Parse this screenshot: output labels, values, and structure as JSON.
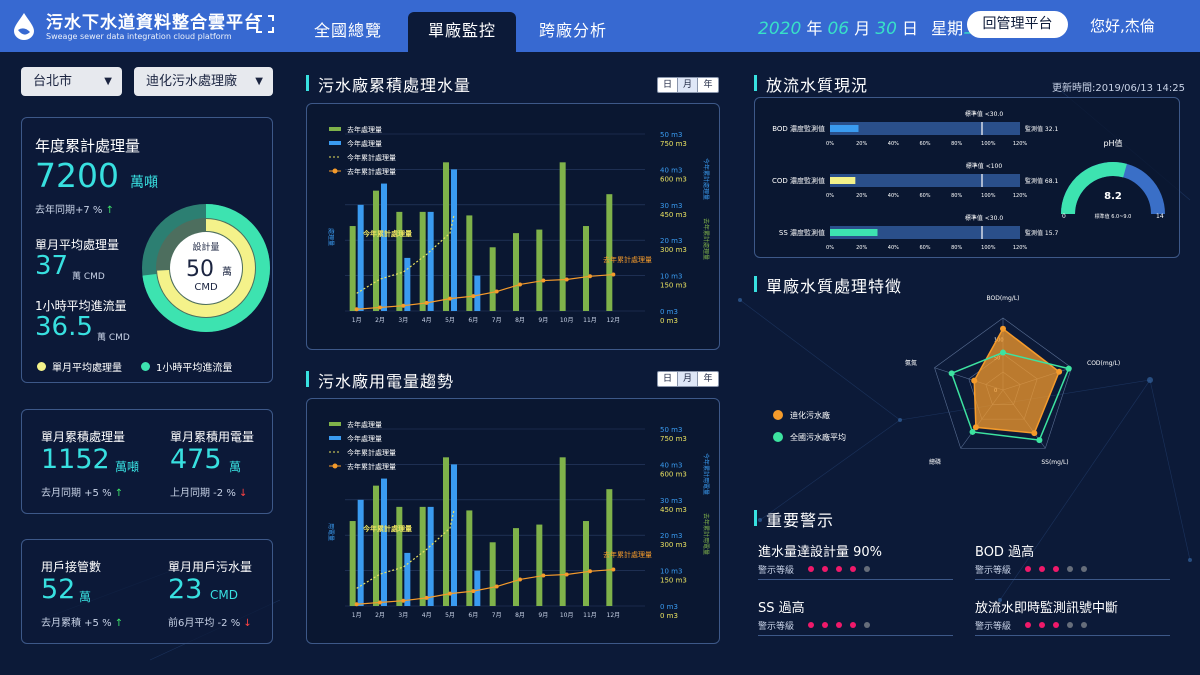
{
  "header": {
    "title": "污水下水道資料整合雲平台",
    "subtitle": "Sweage sewer data integration cloud platform",
    "tabs": [
      "全國總覽",
      "單廠監控",
      "跨廠分析"
    ],
    "date": {
      "year": "2020",
      "y_unit": "年",
      "month": "06",
      "m_unit": "月",
      "day": "30",
      "d_unit": "日",
      "weekday_label": "星期",
      "weekday": "二"
    },
    "admin_button": "回管理平台",
    "greeting": "您好,杰倫"
  },
  "filters": {
    "city": "台北市",
    "plant": "迪化污水處理廠"
  },
  "annual": {
    "title": "年度累計處理量",
    "value": "7200",
    "unit": "萬噸",
    "yoy": "去年同期+7 %",
    "monthly_avg_label": "單月平均處理量",
    "monthly_avg_value": "37",
    "monthly_avg_unit": "萬 CMD",
    "hourly_label": "1小時平均進流量",
    "hourly_value": "36.5",
    "hourly_unit": "萬 CMD",
    "gauge": {
      "label": "設計量",
      "value": "50",
      "unit": "萬",
      "sub": "CMD",
      "ratio_monthly": 0.74,
      "ratio_hourly": 0.73
    },
    "legend": [
      "單月平均處理量",
      "1小時平均進流量"
    ],
    "colors": {
      "monthly": "#f4f28a",
      "hourly": "#3de3b0"
    }
  },
  "monthly": {
    "treat_label": "單月累積處理量",
    "treat_value": "1152",
    "treat_unit": "萬噸",
    "treat_cmp": "去月同期 +5 %",
    "power_label": "單月累積用電量",
    "power_value": "475",
    "power_unit": "萬",
    "power_cmp": "上月同期 -2 %"
  },
  "users": {
    "conn_label": "用戶接管數",
    "conn_value": "52",
    "conn_unit": "萬",
    "conn_cmp": "去月累積 +5 %",
    "usage_label": "單月用戶污水量",
    "usage_value": "23",
    "usage_unit": "CMD",
    "usage_cmp": "前6月平均 -2 %"
  },
  "chart_water": {
    "title": "污水廠累積處理水量",
    "toggle": [
      "日",
      "月",
      "年"
    ],
    "toggle_active": 1
  },
  "chart_power": {
    "title": "污水廠用電量趨勢",
    "toggle": [
      "日",
      "月",
      "年"
    ],
    "toggle_active": 1
  },
  "chart_legend": [
    "去年處理量",
    "今年處理量",
    "今年累計處理量",
    "去年累計處理量"
  ],
  "chart_data": [
    {
      "type": "bar",
      "title": "污水廠累積處理水量",
      "categories": [
        "1月",
        "2月",
        "3月",
        "4月",
        "5月",
        "6月",
        "7月",
        "8月",
        "9月",
        "10月",
        "11月",
        "12月"
      ],
      "series": [
        {
          "name": "去年處理量",
          "values": [
            24,
            34,
            28,
            28,
            42,
            27,
            18,
            22,
            23,
            42,
            24,
            33
          ]
        },
        {
          "name": "今年處理量",
          "values": [
            30,
            36,
            15,
            28,
            40,
            10,
            null,
            null,
            null,
            null,
            null,
            null
          ]
        },
        {
          "name": "今年累計處理量",
          "values": [
            5,
            9,
            11,
            16,
            22,
            null,
            null,
            null,
            null,
            null,
            null,
            null
          ]
        },
        {
          "name": "去年累計處理量",
          "values": [
            0.5,
            1.0,
            1.5,
            2.3,
            3.5,
            4.2,
            5.5,
            7.5,
            8.6,
            8.9,
            9.8,
            10.3
          ]
        }
      ],
      "left_ylabel": "處理量",
      "right_ylabel_1": "今年累計處理量",
      "right_ylabel_2": "去年累計處理量",
      "right_axis_1": [
        "50 m3",
        "40 m3",
        "30 m3",
        "20 m3",
        "10 m3",
        "0 m3"
      ],
      "right_axis_2": [
        "750 m3",
        "600 m3",
        "450 m3",
        "300 m3",
        "150 m3",
        "0 m3"
      ],
      "annotations": [
        "今年累計處理量",
        "去年累計處理量"
      ],
      "ylim": [
        0,
        50
      ]
    },
    {
      "type": "bar",
      "title": "污水廠用電量趨勢",
      "categories": [
        "1月",
        "2月",
        "3月",
        "4月",
        "5月",
        "6月",
        "7月",
        "8月",
        "9月",
        "10月",
        "11月",
        "12月"
      ],
      "series": [
        {
          "name": "去年處理量",
          "values": [
            24,
            34,
            28,
            28,
            42,
            27,
            18,
            22,
            23,
            42,
            24,
            33
          ]
        },
        {
          "name": "今年處理量",
          "values": [
            30,
            36,
            15,
            28,
            40,
            10,
            null,
            null,
            null,
            null,
            null,
            null
          ]
        },
        {
          "name": "今年累計處理量",
          "values": [
            5,
            9,
            11,
            16,
            22,
            null,
            null,
            null,
            null,
            null,
            null,
            null
          ]
        },
        {
          "name": "去年累計處理量",
          "values": [
            0.5,
            1.0,
            1.5,
            2.3,
            3.5,
            4.2,
            5.5,
            7.5,
            8.6,
            8.9,
            9.8,
            10.3
          ]
        }
      ],
      "left_ylabel": "用電量",
      "right_ylabel_1": "今年累計用電量",
      "right_ylabel_2": "去年累計用電量",
      "right_axis_1": [
        "50 m3",
        "40 m3",
        "30 m3",
        "20 m3",
        "10 m3",
        "0 m3"
      ],
      "right_axis_2": [
        "750 m3",
        "600 m3",
        "450 m3",
        "300 m3",
        "150 m3",
        "0 m3"
      ],
      "annotations": [
        "今年累計處理量",
        "去年累計處理量"
      ],
      "ylim": [
        0,
        50
      ]
    }
  ],
  "quality": {
    "title": "放流水質現況",
    "updated": "更新時間:2019/06/13 14:25",
    "bars": [
      {
        "label": "BOD 濃度監測值",
        "std": "標準值 <30.0",
        "std_pct": 80,
        "value_pct": 18,
        "measured": "監測值 32.1",
        "color": "#3a9bf0"
      },
      {
        "label": "COD 濃度監測值",
        "std": "標準值 <100",
        "std_pct": 80,
        "value_pct": 16,
        "measured": "監測值 68.1",
        "color": "#f4f28a"
      },
      {
        "label": "SS 濃度監測值",
        "std": "標準值 <30.0",
        "std_pct": 80,
        "value_pct": 30,
        "measured": "監測值 15.7",
        "color": "#3de3b0"
      }
    ],
    "ticks": [
      "0%",
      "20%",
      "40%",
      "60%",
      "80%",
      "100%",
      "120%"
    ],
    "ph": {
      "title": "pH值",
      "value": "8.2",
      "min": "0",
      "max": "14",
      "std": "標準值 6.0~9.0",
      "level": 0.586
    }
  },
  "radar": {
    "title": "單廠水質處理特徵",
    "axes": [
      "BOD(mg/L)",
      "COD(mg/L)",
      "SS(mg/L)",
      "總磷",
      "氨氮"
    ],
    "ring_labels": [
      "100",
      "50",
      "0"
    ],
    "series": [
      {
        "name": "迪化污水廠",
        "color": "#f59b2b",
        "values": [
          0.85,
          0.82,
          0.74,
          0.64,
          0.42
        ]
      },
      {
        "name": "全國污水廠平均",
        "color": "#3de3a0",
        "values": [
          0.52,
          0.96,
          0.86,
          0.72,
          0.75
        ]
      }
    ]
  },
  "alerts": {
    "title": "重要警示",
    "level_label": "警示等級",
    "items": [
      {
        "title": "進水量達設計量 90%",
        "level": 4
      },
      {
        "title": "BOD 過高",
        "level": 3
      },
      {
        "title": "SS 過高",
        "level": 4
      },
      {
        "title": "放流水即時監測訊號中斷",
        "level": 3
      }
    ]
  }
}
